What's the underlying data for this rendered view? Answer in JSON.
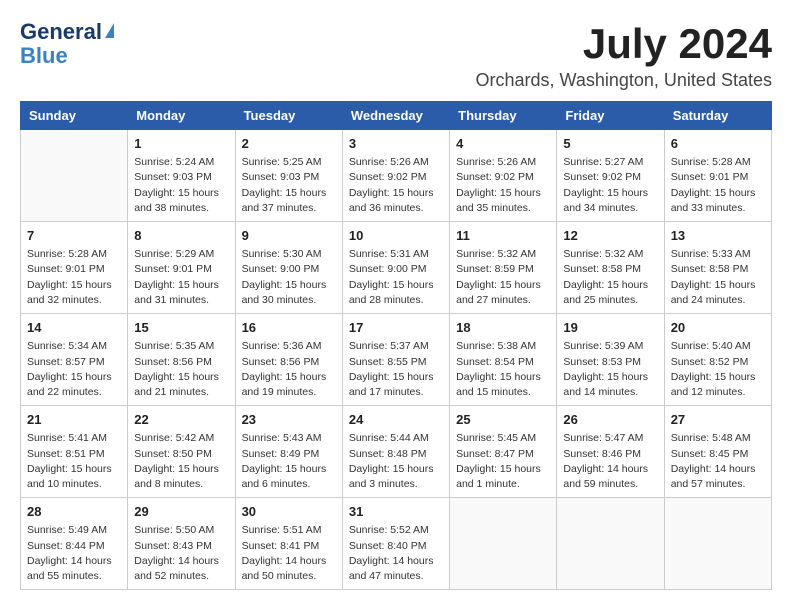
{
  "header": {
    "logo_general": "General",
    "logo_blue": "Blue",
    "month_title": "July 2024",
    "location": "Orchards, Washington, United States"
  },
  "calendar": {
    "days_of_week": [
      "Sunday",
      "Monday",
      "Tuesday",
      "Wednesday",
      "Thursday",
      "Friday",
      "Saturday"
    ],
    "weeks": [
      [
        {
          "day": "",
          "info": ""
        },
        {
          "day": "1",
          "info": "Sunrise: 5:24 AM\nSunset: 9:03 PM\nDaylight: 15 hours\nand 38 minutes."
        },
        {
          "day": "2",
          "info": "Sunrise: 5:25 AM\nSunset: 9:03 PM\nDaylight: 15 hours\nand 37 minutes."
        },
        {
          "day": "3",
          "info": "Sunrise: 5:26 AM\nSunset: 9:02 PM\nDaylight: 15 hours\nand 36 minutes."
        },
        {
          "day": "4",
          "info": "Sunrise: 5:26 AM\nSunset: 9:02 PM\nDaylight: 15 hours\nand 35 minutes."
        },
        {
          "day": "5",
          "info": "Sunrise: 5:27 AM\nSunset: 9:02 PM\nDaylight: 15 hours\nand 34 minutes."
        },
        {
          "day": "6",
          "info": "Sunrise: 5:28 AM\nSunset: 9:01 PM\nDaylight: 15 hours\nand 33 minutes."
        }
      ],
      [
        {
          "day": "7",
          "info": "Sunrise: 5:28 AM\nSunset: 9:01 PM\nDaylight: 15 hours\nand 32 minutes."
        },
        {
          "day": "8",
          "info": "Sunrise: 5:29 AM\nSunset: 9:01 PM\nDaylight: 15 hours\nand 31 minutes."
        },
        {
          "day": "9",
          "info": "Sunrise: 5:30 AM\nSunset: 9:00 PM\nDaylight: 15 hours\nand 30 minutes."
        },
        {
          "day": "10",
          "info": "Sunrise: 5:31 AM\nSunset: 9:00 PM\nDaylight: 15 hours\nand 28 minutes."
        },
        {
          "day": "11",
          "info": "Sunrise: 5:32 AM\nSunset: 8:59 PM\nDaylight: 15 hours\nand 27 minutes."
        },
        {
          "day": "12",
          "info": "Sunrise: 5:32 AM\nSunset: 8:58 PM\nDaylight: 15 hours\nand 25 minutes."
        },
        {
          "day": "13",
          "info": "Sunrise: 5:33 AM\nSunset: 8:58 PM\nDaylight: 15 hours\nand 24 minutes."
        }
      ],
      [
        {
          "day": "14",
          "info": "Sunrise: 5:34 AM\nSunset: 8:57 PM\nDaylight: 15 hours\nand 22 minutes."
        },
        {
          "day": "15",
          "info": "Sunrise: 5:35 AM\nSunset: 8:56 PM\nDaylight: 15 hours\nand 21 minutes."
        },
        {
          "day": "16",
          "info": "Sunrise: 5:36 AM\nSunset: 8:56 PM\nDaylight: 15 hours\nand 19 minutes."
        },
        {
          "day": "17",
          "info": "Sunrise: 5:37 AM\nSunset: 8:55 PM\nDaylight: 15 hours\nand 17 minutes."
        },
        {
          "day": "18",
          "info": "Sunrise: 5:38 AM\nSunset: 8:54 PM\nDaylight: 15 hours\nand 15 minutes."
        },
        {
          "day": "19",
          "info": "Sunrise: 5:39 AM\nSunset: 8:53 PM\nDaylight: 15 hours\nand 14 minutes."
        },
        {
          "day": "20",
          "info": "Sunrise: 5:40 AM\nSunset: 8:52 PM\nDaylight: 15 hours\nand 12 minutes."
        }
      ],
      [
        {
          "day": "21",
          "info": "Sunrise: 5:41 AM\nSunset: 8:51 PM\nDaylight: 15 hours\nand 10 minutes."
        },
        {
          "day": "22",
          "info": "Sunrise: 5:42 AM\nSunset: 8:50 PM\nDaylight: 15 hours\nand 8 minutes."
        },
        {
          "day": "23",
          "info": "Sunrise: 5:43 AM\nSunset: 8:49 PM\nDaylight: 15 hours\nand 6 minutes."
        },
        {
          "day": "24",
          "info": "Sunrise: 5:44 AM\nSunset: 8:48 PM\nDaylight: 15 hours\nand 3 minutes."
        },
        {
          "day": "25",
          "info": "Sunrise: 5:45 AM\nSunset: 8:47 PM\nDaylight: 15 hours\nand 1 minute."
        },
        {
          "day": "26",
          "info": "Sunrise: 5:47 AM\nSunset: 8:46 PM\nDaylight: 14 hours\nand 59 minutes."
        },
        {
          "day": "27",
          "info": "Sunrise: 5:48 AM\nSunset: 8:45 PM\nDaylight: 14 hours\nand 57 minutes."
        }
      ],
      [
        {
          "day": "28",
          "info": "Sunrise: 5:49 AM\nSunset: 8:44 PM\nDaylight: 14 hours\nand 55 minutes."
        },
        {
          "day": "29",
          "info": "Sunrise: 5:50 AM\nSunset: 8:43 PM\nDaylight: 14 hours\nand 52 minutes."
        },
        {
          "day": "30",
          "info": "Sunrise: 5:51 AM\nSunset: 8:41 PM\nDaylight: 14 hours\nand 50 minutes."
        },
        {
          "day": "31",
          "info": "Sunrise: 5:52 AM\nSunset: 8:40 PM\nDaylight: 14 hours\nand 47 minutes."
        },
        {
          "day": "",
          "info": ""
        },
        {
          "day": "",
          "info": ""
        },
        {
          "day": "",
          "info": ""
        }
      ]
    ]
  }
}
